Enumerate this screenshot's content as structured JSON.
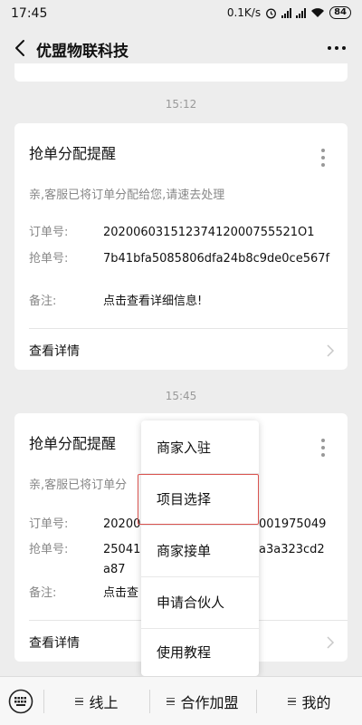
{
  "status_bar": {
    "time": "17:45",
    "net_speed": "0.1K/s",
    "battery": "84"
  },
  "nav": {
    "title": "优盟物联科技"
  },
  "messages": [
    {
      "timestamp": "15:12",
      "title": "抢单分配提醒",
      "desc": "亲,客服已将订单分配给您,请速去处理",
      "fields": [
        {
          "label": "订单号:",
          "value": "20200603151237412000755521O1"
        },
        {
          "label": "抢单号:",
          "value": "7b41bfa5085806dfa24b8c9de0ce567f"
        },
        {
          "label": "备注:",
          "value": "点击查看详细信息!"
        }
      ],
      "detail": "查看详情"
    },
    {
      "timestamp": "15:45",
      "title": "抢单分配提醒",
      "desc": "亲,客服已将订单分",
      "fields": [
        {
          "label": "订单号:",
          "value": "2020060",
          "value_tail": "001975049"
        },
        {
          "label": "抢单号:",
          "value": "25041",
          "value_tail": "a3a323cd2",
          "value_line2": "a87"
        },
        {
          "label": "备注:",
          "value": "点击查"
        }
      ],
      "detail": "查看详情"
    }
  ],
  "popup_menu": {
    "items": [
      "商家入驻",
      "项目选择",
      "商家接单",
      "申请合伙人",
      "使用教程"
    ],
    "highlighted": "项目选择",
    "highlight_color": "#d9534f"
  },
  "bottom_bar": {
    "tabs": [
      "线上",
      "合作加盟",
      "我的"
    ]
  }
}
